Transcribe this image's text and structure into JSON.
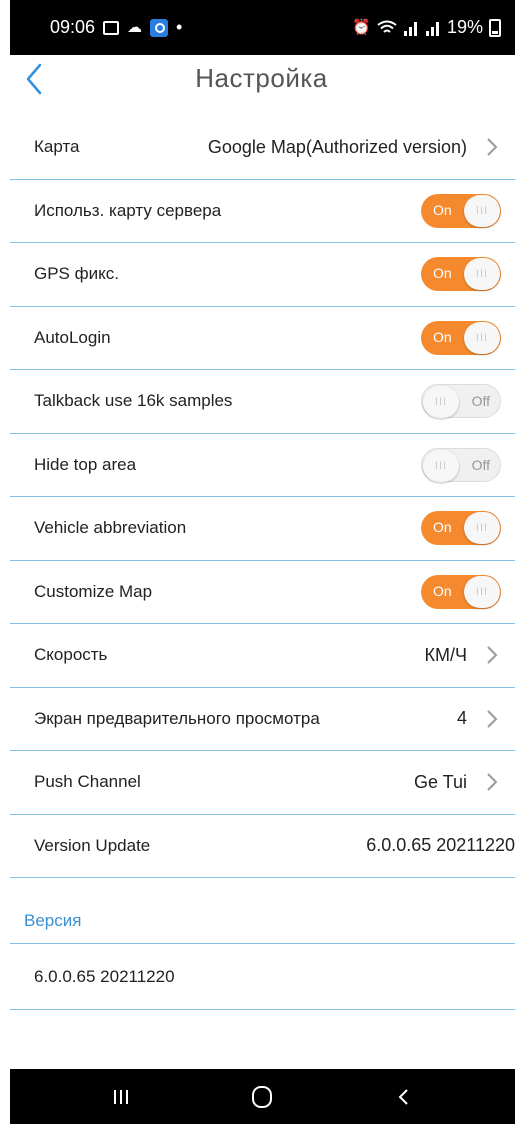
{
  "status_bar": {
    "time": "09:06",
    "dot": "•",
    "battery": "19%",
    "icons_left": [
      "photo-icon",
      "cloud-icon",
      "location-icon"
    ],
    "icons_right": [
      "alarm-icon",
      "wifi-icon",
      "signal-icon",
      "signal-icon",
      "battery-icon"
    ]
  },
  "header": {
    "title": "Настройка",
    "back_icon": "chevron-left-icon"
  },
  "settings": {
    "map": {
      "label": "Карта",
      "value": "Google Map(Authorized version)"
    },
    "use_server_map": {
      "label": "Использ. карту сервера",
      "state": "On",
      "on": true
    },
    "gps_fix": {
      "label": "GPS фикс.",
      "state": "On",
      "on": true
    },
    "autologin": {
      "label": "AutoLogin",
      "state": "On",
      "on": true
    },
    "talkback": {
      "label": "Talkback use 16k samples",
      "state": "Off",
      "on": false
    },
    "hide_top": {
      "label": "Hide top area",
      "state": "Off",
      "on": false
    },
    "vehicle_abbrev": {
      "label": "Vehicle abbreviation",
      "state": "On",
      "on": true
    },
    "customize_map": {
      "label": "Customize Map",
      "state": "On",
      "on": true
    },
    "speed": {
      "label": "Скорость",
      "value": "КМ/Ч"
    },
    "preview_screen": {
      "label": "Экран предварительного просмотра",
      "value": "4"
    },
    "push_channel": {
      "label": "Push Channel",
      "value": "Ge Tui"
    },
    "version_update": {
      "label": "Version Update",
      "value": "6.0.0.65 20211220"
    }
  },
  "version_section": {
    "title": "Версия",
    "value": "6.0.0.65 20211220"
  },
  "toggle_knob": "III",
  "colors": {
    "accent": "#f4892e",
    "divider": "#86c1e6",
    "link_blue": "#3a8fd0",
    "back_blue": "#2f8fe0"
  },
  "android_nav": [
    "recent-apps-icon",
    "home-icon",
    "back-icon"
  ]
}
